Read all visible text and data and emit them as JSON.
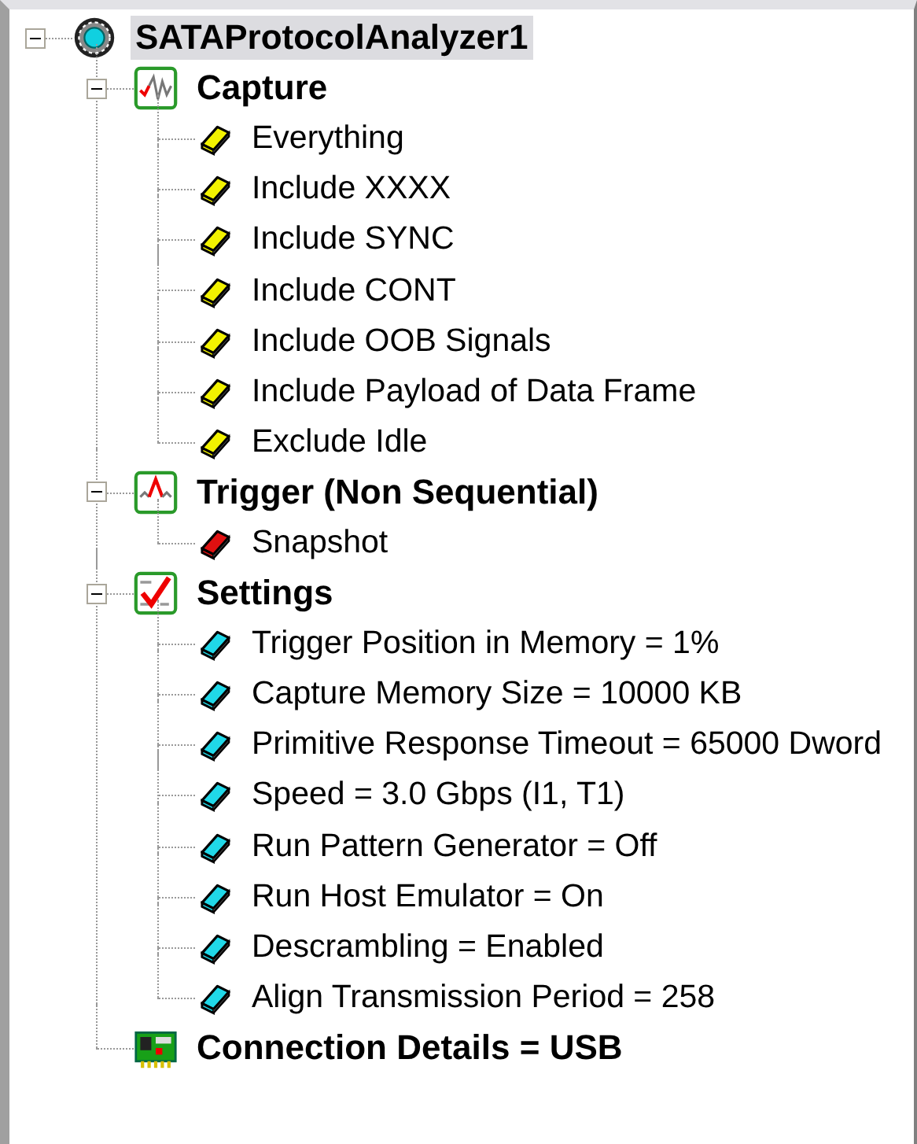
{
  "tree": {
    "label": "SATAProtocolAnalyzer1",
    "kind": "analyzer",
    "selected": true,
    "expanded": true,
    "children": [
      {
        "label": "Capture",
        "kind": "capture",
        "selected": false,
        "expanded": true,
        "children": [
          {
            "label": "Everything",
            "kind": "capture-option",
            "selected": false
          },
          {
            "label": "Include XXXX",
            "kind": "capture-option",
            "selected": false
          },
          {
            "label": "Include SYNC",
            "kind": "capture-option",
            "selected": false
          },
          {
            "label": "Include CONT",
            "kind": "capture-option",
            "selected": false
          },
          {
            "label": "Include OOB Signals",
            "kind": "capture-option",
            "selected": false
          },
          {
            "label": "Include Payload of Data Frame",
            "kind": "capture-option",
            "selected": false
          },
          {
            "label": "Exclude Idle",
            "kind": "capture-option",
            "selected": false
          }
        ]
      },
      {
        "label": "Trigger (Non Sequential)",
        "kind": "trigger",
        "selected": false,
        "expanded": true,
        "children": [
          {
            "label": "Snapshot",
            "kind": "trigger-option",
            "selected": false
          }
        ]
      },
      {
        "label": "Settings",
        "kind": "settings",
        "selected": false,
        "expanded": true,
        "children": [
          {
            "label": "Trigger Position in Memory = 1%",
            "kind": "setting",
            "selected": false
          },
          {
            "label": "Capture Memory Size = 10000 KB",
            "kind": "setting",
            "selected": false
          },
          {
            "label": "Primitive Response Timeout = 65000 Dword",
            "kind": "setting",
            "selected": false
          },
          {
            "label": "Speed = 3.0 Gbps (I1, T1)",
            "kind": "setting",
            "selected": false
          },
          {
            "label": "Run Pattern Generator = Off",
            "kind": "setting",
            "selected": false
          },
          {
            "label": "Run Host Emulator = On",
            "kind": "setting",
            "selected": false
          },
          {
            "label": "Descrambling = Enabled",
            "kind": "setting",
            "selected": false
          },
          {
            "label": "Align Transmission Period = 258",
            "kind": "setting",
            "selected": false
          }
        ]
      },
      {
        "label": "Connection Details = USB",
        "kind": "connection",
        "selected": false
      }
    ]
  }
}
